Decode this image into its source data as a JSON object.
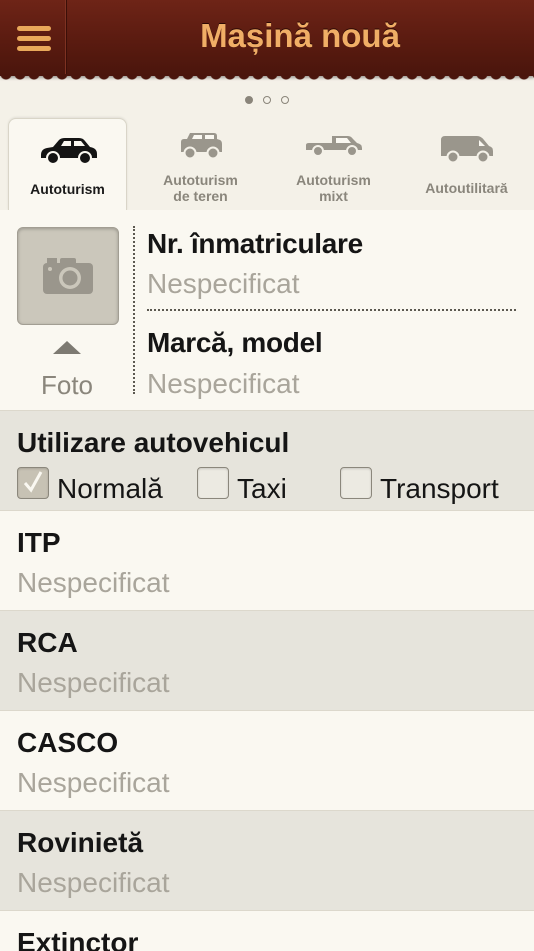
{
  "header": {
    "title": "Mașină nouă",
    "menu_icon": "hamburger-icon"
  },
  "pager": {
    "count": 3,
    "active": 0
  },
  "tabs": [
    {
      "label": "Autoturism",
      "icon": "car-icon",
      "active": true
    },
    {
      "label": "Autoturism de teren",
      "icon": "suv-icon",
      "active": false
    },
    {
      "label": "Autoturism mixt",
      "icon": "pickup-icon",
      "active": false
    },
    {
      "label": "Autoutilitară",
      "icon": "van-icon",
      "active": false
    }
  ],
  "photo": {
    "label": "Foto",
    "icon": "camera-icon"
  },
  "fields": [
    {
      "label": "Nr. înmatriculare",
      "value": "Nespecificat"
    },
    {
      "label": "Marcă, model",
      "value": "Nespecificat"
    }
  ],
  "usage": {
    "label": "Utilizare autovehicul",
    "options": [
      {
        "label": "Normală",
        "checked": true
      },
      {
        "label": "Taxi",
        "checked": false
      },
      {
        "label": "Transport",
        "checked": false
      }
    ]
  },
  "sections": [
    {
      "label": "ITP",
      "value": "Nespecificat"
    },
    {
      "label": "RCA",
      "value": "Nespecificat"
    },
    {
      "label": "CASCO",
      "value": "Nespecificat"
    },
    {
      "label": "Rovinietă",
      "value": "Nespecificat"
    },
    {
      "label": "Extinctor",
      "value": ""
    }
  ],
  "colors": {
    "header": "#5a1b10",
    "title": "#f0ae66",
    "placeholder": "#a9a59b"
  }
}
